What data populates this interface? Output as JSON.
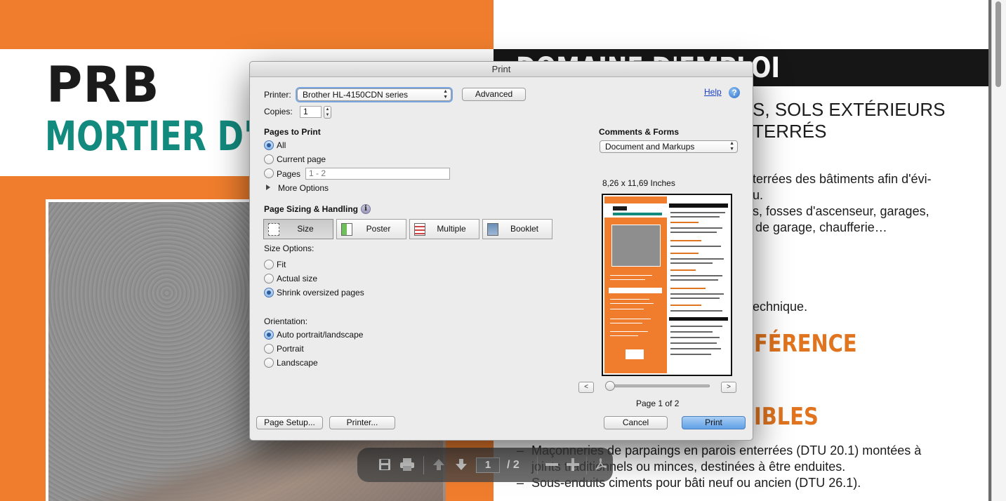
{
  "background_doc": {
    "title_line1": "PRB",
    "title_line2": "MORTIER D'IMP",
    "section_header": "DOMAINE D'EMPLOI",
    "right_line1": "S, SOLS EXTÉRIEURS",
    "right_line2": "TERRÉS",
    "right_body1": "terrées des bâtiments afin d'évi-",
    "right_body2": "u.",
    "right_body3": "s, fosses d'ascenseur, garages,",
    "right_body4": "de garage, chaufferie…",
    "right_body5": "echnique.",
    "orange_heading1": "FÉRENCE",
    "orange_heading2": "IBLES",
    "bullet1_line1": "Maçonneries de parpaings en parois enterrées (DTU 20.1) montées à",
    "bullet1_line2": "joints traditionnels ou minces, destinées à être enduites.",
    "bullet2": "Sous-enduits ciments pour bâti neuf ou ancien (DTU 26.1).",
    "bullet_dash": "–",
    "colors": {
      "orange": "#ef7d2d",
      "teal": "#138a7e",
      "black_band": "#161616"
    }
  },
  "pdf_toolbar": {
    "icons": [
      "save-icon",
      "print-icon",
      "page-up-icon",
      "page-down-icon",
      "zoom-out-icon",
      "zoom-in-icon",
      "acrobat-icon"
    ],
    "current_page": "1",
    "page_total": "/ 2"
  },
  "dialog": {
    "title": "Print",
    "printer_label": "Printer:",
    "printer_value": "Brother HL-4150CDN series",
    "advanced_button": "Advanced",
    "help_link": "Help",
    "copies_label": "Copies:",
    "copies_value": "1",
    "pages_to_print": {
      "heading": "Pages to Print",
      "options": [
        "All",
        "Current page",
        "Pages"
      ],
      "selected": "All",
      "pages_range_placeholder": "1 - 2",
      "more_options": "More Options"
    },
    "page_sizing": {
      "heading": "Page Sizing & Handling",
      "modes": [
        "Size",
        "Poster",
        "Multiple",
        "Booklet"
      ],
      "selected_mode": "Size",
      "size_options_label": "Size Options:",
      "size_options": [
        "Fit",
        "Actual size",
        "Shrink oversized pages"
      ],
      "selected_size_option": "Shrink oversized pages"
    },
    "orientation": {
      "heading": "Orientation:",
      "options": [
        "Auto portrait/landscape",
        "Portrait",
        "Landscape"
      ],
      "selected": "Auto portrait/landscape"
    },
    "comments_forms": {
      "heading": "Comments & Forms",
      "value": "Document and Markups"
    },
    "preview": {
      "paper_size": "8,26 x 11,69 Inches",
      "prev_button": "<",
      "next_button": ">",
      "page_indicator": "Page 1 of 2",
      "current_page": 1,
      "total_pages": 2
    },
    "footer": {
      "page_setup": "Page Setup...",
      "printer": "Printer...",
      "cancel": "Cancel",
      "print": "Print"
    },
    "colors": {
      "accent": "#5f9fe6",
      "link": "#1a3fc4"
    }
  }
}
